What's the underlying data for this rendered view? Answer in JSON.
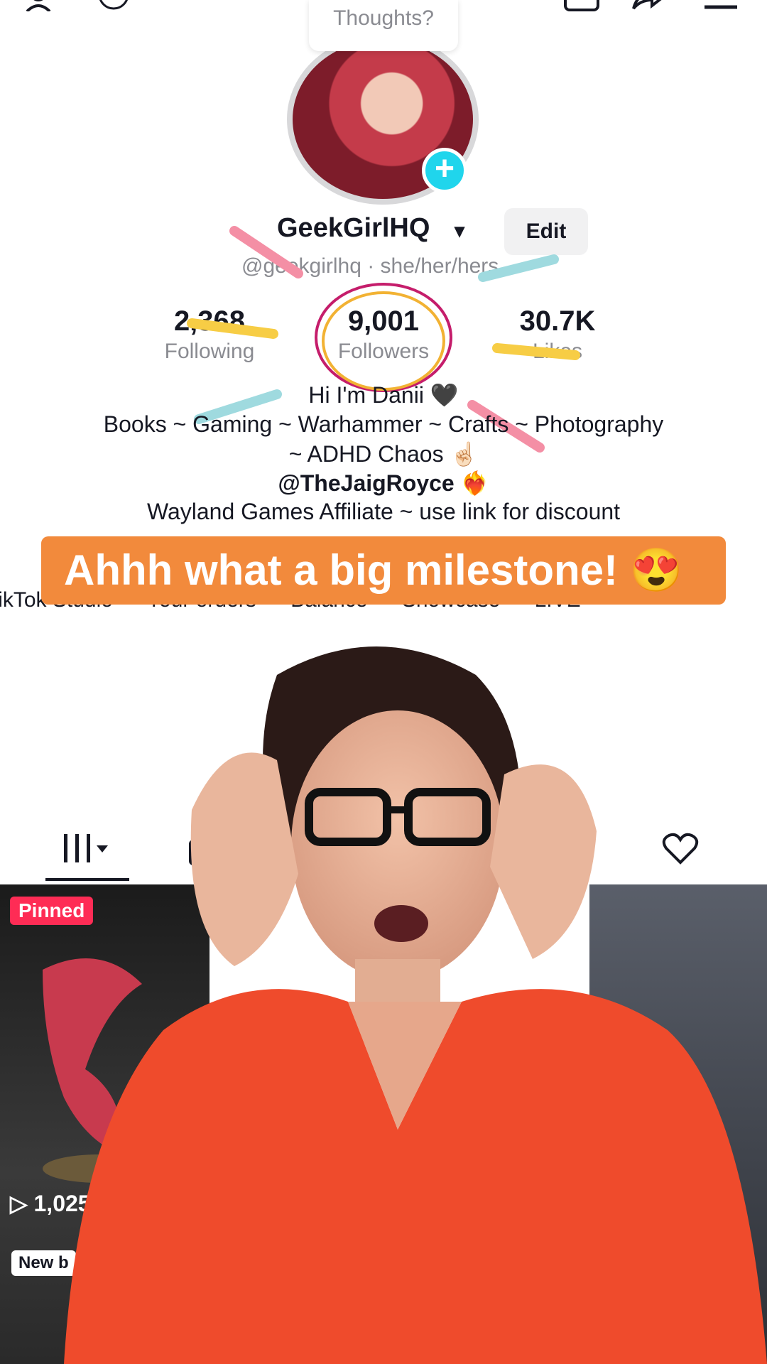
{
  "popup": {
    "thoughts": "Thoughts?"
  },
  "profile": {
    "username": "GeekGirlHQ",
    "edit_label": "Edit",
    "handle": "@geekgirlhq · she/her/hers"
  },
  "stats": [
    {
      "value": "2,368",
      "label": "Following"
    },
    {
      "value": "9,001",
      "label": "Followers"
    },
    {
      "value": "30.7K",
      "label": "Likes"
    }
  ],
  "bio": {
    "line1": "Hi I'm Danii 🖤",
    "line2": "Books ~ Gaming ~ Warhammer ~ Crafts ~ Photography",
    "line3": "~ ADHD Chaos ☝🏻",
    "line4": "@TheJaigRoyce ❤️‍🔥",
    "line5": "Wayland Games Affiliate ~ use link for discount"
  },
  "caption": "Ahhh what a big milestone! 😍",
  "shortcuts": [
    "TikTok Studio",
    "Your orders",
    "Balance",
    "Showcase",
    "LIVE"
  ],
  "video": {
    "pinned_label": "Pinned",
    "views": "1,025",
    "badge": "New b"
  },
  "colors": {
    "banner": "#f28a3c",
    "pinned": "#fe2c55",
    "plus": "#20d5ec"
  }
}
